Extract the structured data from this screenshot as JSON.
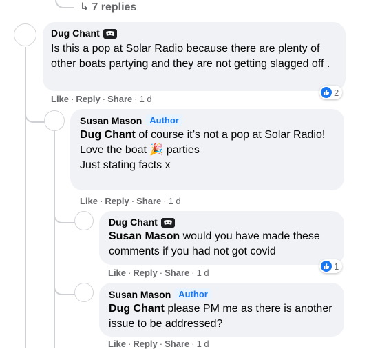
{
  "thread": {
    "view_replies_label": "7 replies",
    "comments": [
      {
        "author": "Dug Chant",
        "text": "Is this a pop at Solar Radio because there are plenty of other boats partying and they are not getting slagged off .",
        "reaction_count": "2",
        "actions": {
          "like": "Like",
          "reply": "Reply",
          "share": "Share",
          "time": "1 d"
        }
      },
      {
        "author": "Susan Mason",
        "badge": "Author",
        "mention": "Dug Chant",
        "text_a": " of course it’s not a pop at Solar Radio!",
        "text_b_1": "Love the boat ",
        "text_b_emoji": "🎉",
        "text_b_2": " parties",
        "text_c": "Just stating facts x",
        "actions": {
          "like": "Like",
          "reply": "Reply",
          "share": "Share",
          "time": "1 d"
        }
      },
      {
        "author": "Dug Chant",
        "mention": "Susan Mason",
        "text": " would you have made these comments if you had not got covid",
        "reaction_count": "1",
        "actions": {
          "like": "Like",
          "reply": "Reply",
          "share": "Share",
          "time": "1 d"
        }
      },
      {
        "author": "Susan Mason",
        "badge": "Author",
        "mention": "Dug Chant",
        "text": " please PM me as there is another issue to be addressed?",
        "actions": {
          "like": "Like",
          "reply": "Reply",
          "share": "Share",
          "time": "1 d"
        }
      }
    ]
  },
  "colors": {
    "bubble": "#f0f2f5",
    "link": "#1877f2",
    "meta": "#65676b",
    "thread_line": "#ced0d4"
  },
  "icons": {
    "reply_arrow": "reply-arrow-icon",
    "like": "thumbs-up-icon",
    "top_fan": "top-fan-badge-icon"
  }
}
